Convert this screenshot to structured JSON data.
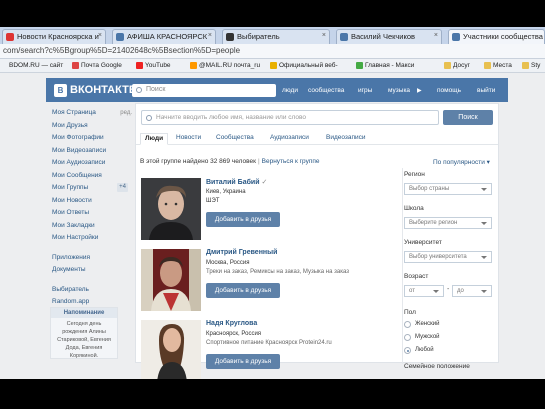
{
  "browser": {
    "tabs": [
      {
        "label": "Новости Красноярска и",
        "active": false
      },
      {
        "label": "АФИША КРАСНОЯРСК",
        "active": false
      },
      {
        "label": "Выбиратель",
        "active": false
      },
      {
        "label": "Василий Чекчиков",
        "active": false
      },
      {
        "label": "Участники сообщества",
        "active": true
      }
    ],
    "url_path": "com/search?c%5Bgroup%5D=21402648c%5Bsection%5D=people",
    "bookmarks": [
      "BDOM.RU — сайт",
      "Почта Google",
      "YouTube",
      "@MAIL.RU почта_ru",
      "Официальный веб-",
      "Главная - Макси",
      "Досуг",
      "Места",
      "Sty"
    ]
  },
  "header": {
    "logo_text": "ВКОНТАКТЕ",
    "logo_badge": "В",
    "search_placeholder": "Поиск",
    "nav": [
      "люди",
      "сообщества",
      "игры",
      "музыка",
      "помощь",
      "выйти"
    ]
  },
  "left_menu": {
    "items": [
      {
        "label": "Моя Страница",
        "extra": "ред."
      },
      {
        "label": "Мои Друзья",
        "extra": ""
      },
      {
        "label": "Мои Фотографии",
        "extra": ""
      },
      {
        "label": "Мои Видеозаписи",
        "extra": ""
      },
      {
        "label": "Мои Аудиозаписи",
        "extra": ""
      },
      {
        "label": "Мои Сообщения",
        "extra": ""
      },
      {
        "label": "Мои Группы",
        "extra": "+4"
      },
      {
        "label": "Мои Новости",
        "extra": ""
      },
      {
        "label": "Мои Ответы",
        "extra": ""
      },
      {
        "label": "Мои Закладки",
        "extra": ""
      },
      {
        "label": "Мои Настройки",
        "extra": ""
      }
    ],
    "items2": [
      "Приложения",
      "Документы"
    ],
    "items3": [
      "Выбиратель",
      "Random.app"
    ],
    "reminder_title": "Напоминание",
    "reminder_text": "Сегодня день рождения Алины Стариковой, Евгения Дода, Евгения Корякиной."
  },
  "search": {
    "placeholder": "Начните вводить любое имя, название или слово",
    "button": "Поиск",
    "tabs": [
      "Люди",
      "Новости",
      "Сообщества",
      "Аудиозаписи",
      "Видеозаписи"
    ],
    "found_text": "В этой группе найдено 32 869 человек",
    "back_link": "Вернуться к группе",
    "sort": "По популярности"
  },
  "people": [
    {
      "name": "Виталий Бабий",
      "verified": true,
      "city": "Киев, Украина",
      "info": "ШЭТ",
      "button": "Добавить в друзья"
    },
    {
      "name": "Дмитрий Гревенный",
      "verified": false,
      "city": "Москва, Россия",
      "info": "Треки на заказ, Ремиксы на заказ, Музыка на заказ",
      "button": "Добавить в друзья"
    },
    {
      "name": "Надя Круглова",
      "verified": false,
      "city": "Красноярск, Россия",
      "info": "Спортивное питание Красноярск Protein24.ru",
      "button": "Добавить в друзья"
    }
  ],
  "filters": {
    "region_label": "Регион",
    "region_value": "Выбор страны",
    "school_label": "Школа",
    "school_value": "Выберите регион",
    "university_label": "Университет",
    "university_value": "Выбор университета",
    "age_label": "Возраст",
    "age_from": "от",
    "age_to": "до",
    "age_dash": "-",
    "gender_label": "Пол",
    "gender_options": [
      "Женский",
      "Мужской",
      "Любой"
    ],
    "gender_selected": "Любой",
    "marital_label": "Семейное положение"
  },
  "colors": {
    "vk_blue": "#4a76a8",
    "button_blue": "#5e81a8",
    "link": "#2a5885"
  }
}
